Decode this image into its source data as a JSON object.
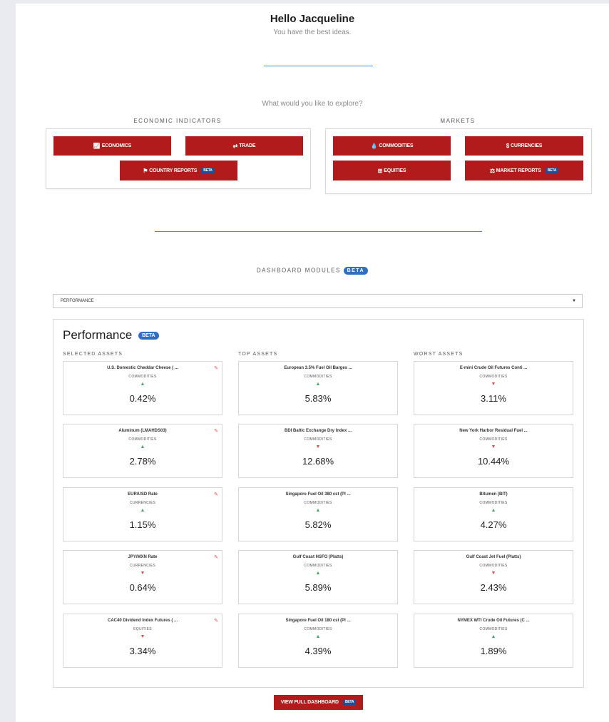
{
  "greeting": {
    "title": "Hello Jacqueline",
    "subtitle": "You have the best ideas."
  },
  "explore": {
    "prompt": "What would you like to explore?"
  },
  "economic": {
    "heading": "ECONOMIC INDICATORS",
    "buttons": [
      {
        "icon": "📈",
        "label": "ECONOMICS"
      },
      {
        "icon": "⇄",
        "label": "TRADE"
      },
      {
        "icon": "⚑",
        "label": "COUNTRY REPORTS",
        "badge": "BETA"
      }
    ]
  },
  "markets": {
    "heading": "MARKETS",
    "buttons": [
      {
        "icon": "💧",
        "label": "COMMODITIES"
      },
      {
        "icon": "$",
        "label": "CURRENCIES"
      },
      {
        "icon": "⊞",
        "label": "EQUITIES"
      },
      {
        "icon": "⚖",
        "label": "MARKET REPORTS",
        "badge": "BETA"
      }
    ]
  },
  "modules": {
    "heading": "DASHBOARD MODULES",
    "badge": "BETA",
    "select_value": "PERFORMANCE"
  },
  "performance": {
    "title": "Performance",
    "badge": "BETA",
    "columns": [
      {
        "heading": "SELECTED ASSETS",
        "cards": [
          {
            "name": "U.S. Domestic Cheddar Cheese ( ...",
            "category": "COMMODITIES",
            "direction": "up",
            "value": "0.42%"
          },
          {
            "name": "Aluminum (LMAHDS03)",
            "category": "COMMODITIES",
            "direction": "up",
            "value": "2.78%"
          },
          {
            "name": "EUR/USD Rate",
            "category": "CURRENCIES",
            "direction": "up",
            "value": "1.15%"
          },
          {
            "name": "JPY/MXN Rate",
            "category": "CURRENCIES",
            "direction": "down",
            "value": "0.64%"
          },
          {
            "name": "CAC40 Dividend Index Futures ( ...",
            "category": "EQUITIES",
            "direction": "down",
            "value": "3.34%"
          }
        ]
      },
      {
        "heading": "TOP ASSETS",
        "cards": [
          {
            "name": "European 3.5% Fuel Oil Barges ...",
            "category": "COMMODITIES",
            "direction": "up",
            "value": "5.83%"
          },
          {
            "name": "BDI Baltic Exchange Dry Index ...",
            "category": "COMMODITIES",
            "direction": "down",
            "value": "12.68%"
          },
          {
            "name": "Singapore Fuel Oil 380 cst (Pl ...",
            "category": "COMMODITIES",
            "direction": "up",
            "value": "5.82%"
          },
          {
            "name": "Gulf Coast HSFO (Platts)",
            "category": "COMMODITIES",
            "direction": "up",
            "value": "5.89%"
          },
          {
            "name": "Singapore Fuel Oil 180 cst (Pl ...",
            "category": "COMMODITIES",
            "direction": "up",
            "value": "4.39%"
          }
        ]
      },
      {
        "heading": "WORST ASSETS",
        "cards": [
          {
            "name": "E-mini Crude Oil Futures Conti ...",
            "category": "COMMODITIES",
            "direction": "down",
            "value": "3.11%"
          },
          {
            "name": "New York Harbor Residual Fuel ...",
            "category": "COMMODITIES",
            "direction": "down",
            "value": "10.44%"
          },
          {
            "name": "Bitumen (BIT)",
            "category": "COMMODITIES",
            "direction": "up",
            "value": "4.27%"
          },
          {
            "name": "Gulf Coast Jet Fuel (Platts)",
            "category": "COMMODITIES",
            "direction": "down",
            "value": "2.43%"
          },
          {
            "name": "NYMEX WTI Crude Oil Futures (C ...",
            "category": "COMMODITIES",
            "direction": "up",
            "value": "1.89%"
          }
        ]
      }
    ]
  },
  "footer": {
    "button_label": "VIEW FULL DASHBOARD",
    "badge": "BETA"
  },
  "icons": {
    "up": "▲",
    "down": "▼",
    "edit": "pencil-icon",
    "caret": "caret-down-icon"
  },
  "colors": {
    "button_red": "#b11b1b",
    "accent_blue": "#3d8fd6",
    "beta_blue": "#2f6fc2",
    "up_green": "#4aa56a",
    "down_red": "#d9534f"
  }
}
